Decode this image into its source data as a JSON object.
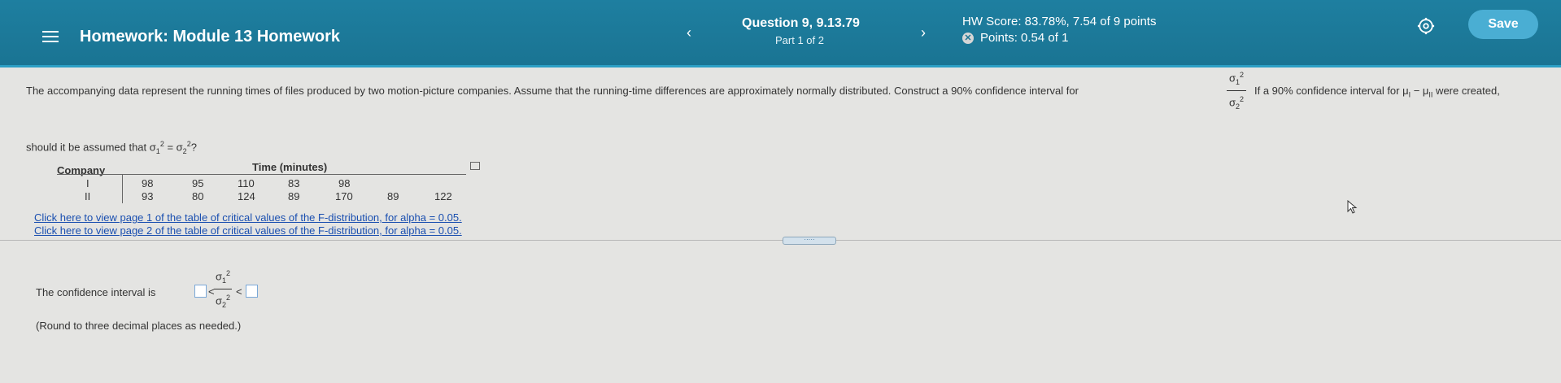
{
  "header": {
    "title": "Homework: Module 13 Homework",
    "question_title": "Question 9, 9.13.79",
    "question_part": "Part 1 of 2",
    "hw_score": "HW Score: 83.78%, 7.54 of 9 points",
    "points": "Points: 0.54 of 1",
    "prev_arrow": "‹",
    "next_arrow": "›",
    "save_label": "Save"
  },
  "question": {
    "text": "The accompanying data represent the running times of files produced by two motion-picture companies. Assume that the running-time differences are approximately normally distributed. Construct a 90% confidence interval for",
    "text_after": "If a 90% confidence interval for μ",
    "text_after_end": " were created,",
    "line2_start": "should it be assumed that σ",
    "line2_end": "?"
  },
  "table": {
    "header_company": "Company",
    "header_time": "Time (minutes)",
    "rows": [
      {
        "company": "I",
        "values": [
          "98",
          "95",
          "110",
          "83",
          "98"
        ]
      },
      {
        "company": "II",
        "values": [
          "93",
          "80",
          "124",
          "89",
          "170",
          "89",
          "122"
        ]
      }
    ]
  },
  "links": {
    "page1": "Click here to view page 1 of the table of critical values of the F-distribution, for alpha = 0.05.",
    "page2": "Click here to view page 2 of the table of critical values of the F-distribution, for alpha = 0.05."
  },
  "answer": {
    "prefix": "The confidence interval is",
    "note": "(Round to three decimal places as needed.)",
    "lower_value": "",
    "upper_value": ""
  },
  "colors": {
    "header_bg": "#1a7493",
    "save_button": "#4aaed3",
    "link": "#1a4fb0"
  },
  "icons": [
    "menu-icon",
    "prev-arrow-icon",
    "next-arrow-icon",
    "incorrect-icon",
    "gear-icon",
    "copy-icon",
    "cursor-icon"
  ]
}
